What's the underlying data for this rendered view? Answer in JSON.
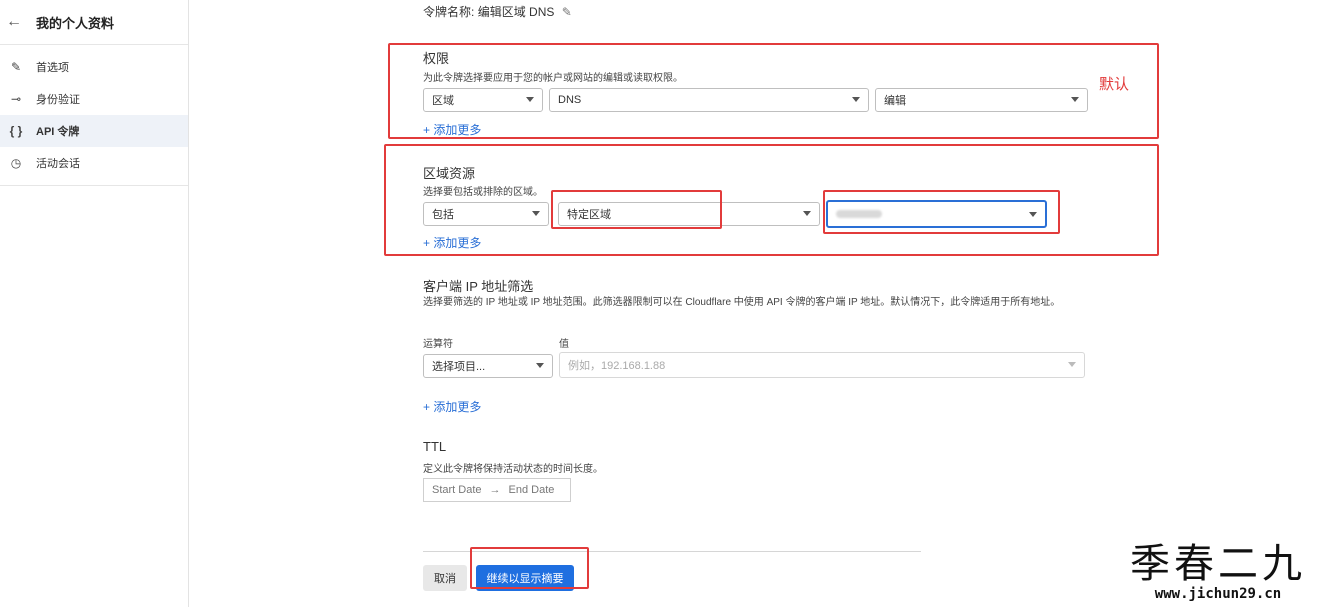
{
  "sidebar": {
    "back_icon": "arrow-left-icon",
    "title": "我的个人资料",
    "items": [
      {
        "label": "首选项",
        "icon": "pencil-icon",
        "glyph": "✎"
      },
      {
        "label": "身份验证",
        "icon": "key-icon",
        "glyph": "⊸"
      },
      {
        "label": "API 令牌",
        "icon": "braces-icon",
        "glyph": "{ }",
        "active": true
      },
      {
        "label": "活动会话",
        "icon": "clock-icon",
        "glyph": "◷"
      }
    ]
  },
  "token": {
    "name_prefix": "令牌名称:",
    "name_value": "编辑区域 DNS",
    "edit_glyph": "✎"
  },
  "permissions": {
    "heading": "权限",
    "description": "为此令牌选择要应用于您的帐户或网站的编辑或读取权限。",
    "select1": "区域",
    "select2": "DNS",
    "select3": "编辑",
    "add_more": "+ 添加更多",
    "annotation": "默认"
  },
  "zone_resources": {
    "heading": "区域资源",
    "description": "选择要包括或排除的区域。",
    "select1": "包括",
    "select2": "特定区域",
    "select3": "",
    "add_more": "+ 添加更多"
  },
  "ip_filter": {
    "heading": "客户端 IP 地址筛选",
    "description": "选择要筛选的 IP 地址或 IP 地址范围。此筛选器限制可以在 Cloudflare 中使用 API 令牌的客户端 IP 地址。默认情况下，此令牌适用于所有地址。",
    "operator_label": "运算符",
    "value_label": "值",
    "operator_select": "选择项目...",
    "value_placeholder": "例如，192.168.1.88",
    "add_more": "+ 添加更多"
  },
  "ttl": {
    "heading": "TTL",
    "description": "定义此令牌将保持活动状态的时间长度。",
    "start": "Start Date",
    "arrow": "→",
    "end": "End Date"
  },
  "actions": {
    "cancel": "取消",
    "continue": "继续以显示摘要"
  },
  "watermark": {
    "big": "季春二九",
    "url": "www.jichun29.cn"
  },
  "colors": {
    "accent": "#1f6fe0",
    "annotation_red": "#e23b3b"
  }
}
